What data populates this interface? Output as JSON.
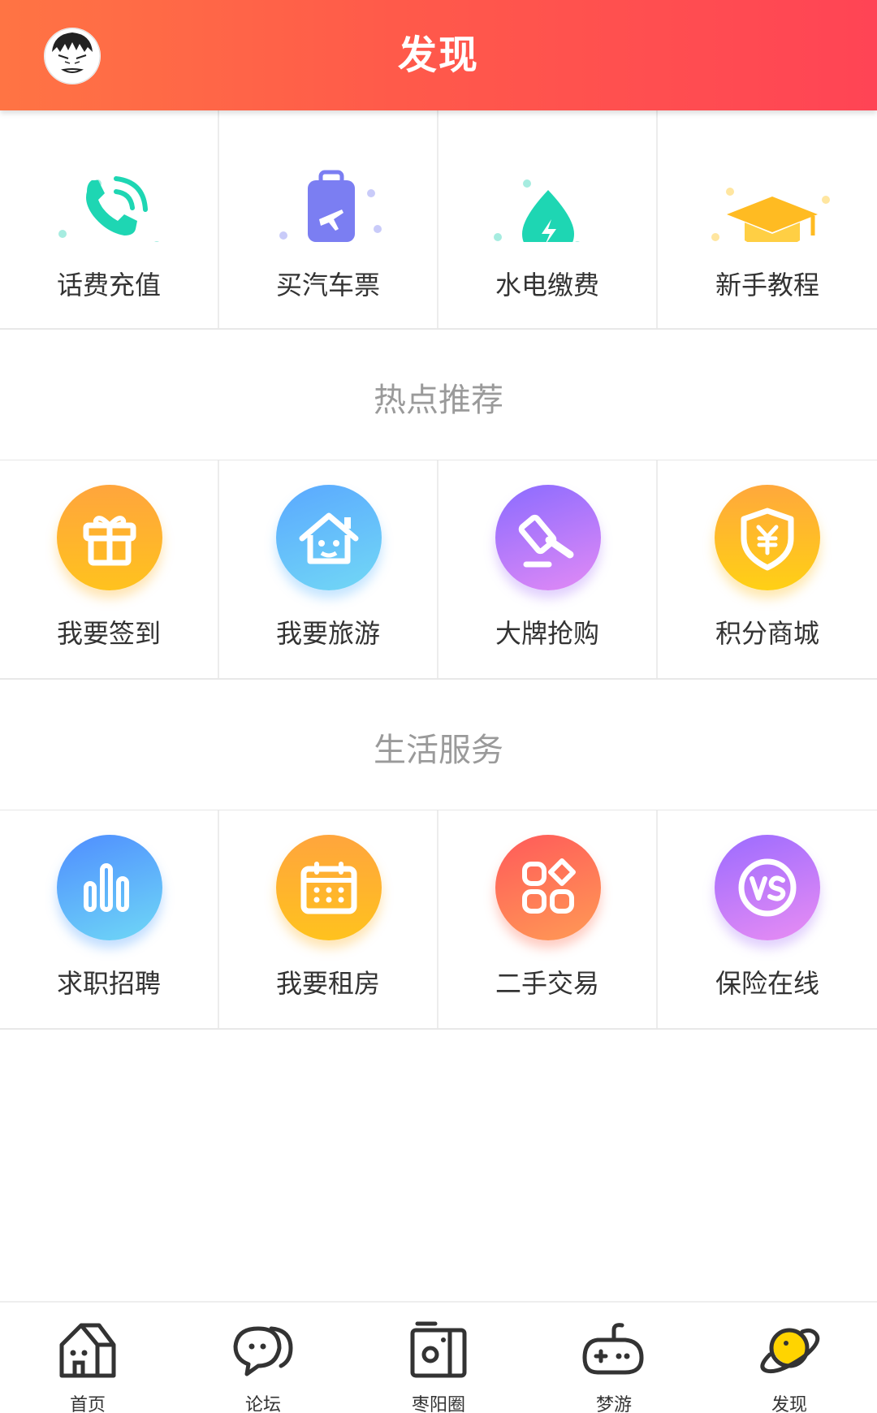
{
  "header": {
    "title": "发现",
    "avatar_icon": "avatar-icon"
  },
  "quick_services": [
    {
      "label": "话费充值",
      "icon": "phone-icon",
      "color": "#1ed6b3"
    },
    {
      "label": "买汽车票",
      "icon": "luggage-plane-icon",
      "color": "#7b7ef2"
    },
    {
      "label": "水电缴费",
      "icon": "water-drop-icon",
      "color": "#1ed6b3"
    },
    {
      "label": "新手教程",
      "icon": "graduation-cap-icon",
      "color": "#ffbb22"
    }
  ],
  "hot": {
    "title": "热点推荐",
    "items": [
      {
        "label": "我要签到",
        "icon": "gift-icon"
      },
      {
        "label": "我要旅游",
        "icon": "house-icon"
      },
      {
        "label": "大牌抢购",
        "icon": "auction-hammer-icon"
      },
      {
        "label": "积分商城",
        "icon": "yen-shield-icon"
      }
    ]
  },
  "life": {
    "title": "生活服务",
    "items": [
      {
        "label": "求职招聘",
        "icon": "bar-chart-icon"
      },
      {
        "label": "我要租房",
        "icon": "calendar-icon"
      },
      {
        "label": "二手交易",
        "icon": "apps-icon"
      },
      {
        "label": "保险在线",
        "icon": "vs-icon"
      }
    ]
  },
  "nav": [
    {
      "label": "首页",
      "icon": "home-icon"
    },
    {
      "label": "论坛",
      "icon": "chat-bubbles-icon"
    },
    {
      "label": "枣阳圈",
      "icon": "radio-icon"
    },
    {
      "label": "梦游",
      "icon": "gamepad-icon"
    },
    {
      "label": "发现",
      "icon": "planet-icon"
    }
  ]
}
